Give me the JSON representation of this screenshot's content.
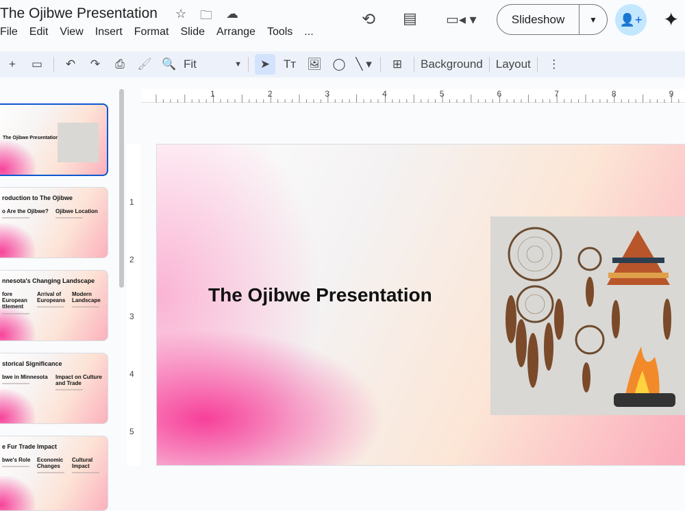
{
  "app": {
    "title": "The Ojibwe Presentation"
  },
  "menu": [
    "File",
    "Edit",
    "View",
    "Insert",
    "Format",
    "Slide",
    "Arrange",
    "Tools",
    "..."
  ],
  "header": {
    "slideshow_label": "Slideshow"
  },
  "toolbar": {
    "zoom_value": "Fit",
    "background_label": "Background",
    "layout_label": "Layout"
  },
  "ruler": {
    "top": [
      "1",
      "2",
      "3",
      "4",
      "5",
      "6",
      "7",
      "8",
      "9"
    ],
    "left": [
      "1",
      "2",
      "3",
      "4",
      "5"
    ]
  },
  "slides": [
    {
      "title": "The Ojibwe Presentation",
      "columns": []
    },
    {
      "title": "roduction to The Ojibwe",
      "columns": [
        "o Are the Ojibwe?",
        "Ojibwe Location"
      ]
    },
    {
      "title": "nnesota's Changing Landscape",
      "columns": [
        "fore European ttlement",
        "Arrival of Europeans",
        "Modern Landscape"
      ]
    },
    {
      "title": "storical Significance",
      "columns": [
        "bwe in Minnesota",
        "Impact on Culture and Trade"
      ]
    },
    {
      "title": "e Fur Trade Impact",
      "columns": [
        "bwe's Role",
        "Economic Changes",
        "Cultural Impact"
      ]
    }
  ],
  "main_slide": {
    "title": "The Ojibwe Presentation"
  },
  "colors": {
    "accent": "#0b57d0",
    "share_bg": "#c2e7ff",
    "toolbar_bg": "#edf2fa"
  }
}
